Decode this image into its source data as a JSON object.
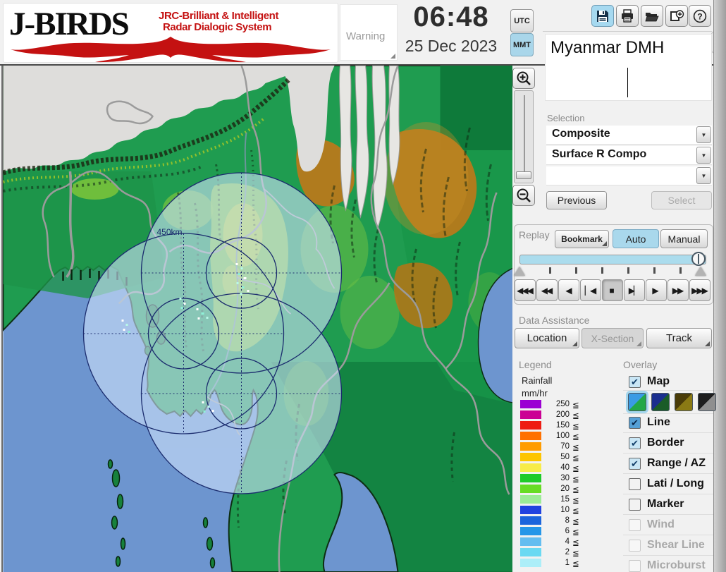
{
  "header": {
    "logo_title": "J-BIRDS",
    "logo_sub1": "JRC-Brilliant & Intelligent",
    "logo_sub2": "Radar  Dialogic  System",
    "warning_label": "Warning",
    "time": "06:48",
    "date": "25 Dec 2023",
    "tz_utc": "UTC",
    "tz_mmt": "MMT",
    "tz_selected": "MMT",
    "toolbar_icons": [
      "save-icon",
      "print-icon",
      "open-folder-icon",
      "add-image-icon",
      "help-icon"
    ],
    "station_name": "Myanmar DMH"
  },
  "selection": {
    "label": "Selection",
    "dropdown1": "Composite",
    "dropdown2": "Surface R Compo",
    "dropdown3": "",
    "previous_label": "Previous",
    "select_label": "Select",
    "select_enabled": false
  },
  "replay": {
    "label": "Replay",
    "bookmark_label": "Bookmark",
    "auto_label": "Auto",
    "manual_label": "Manual",
    "mode_selected": "Auto",
    "slider_position_pct": 100,
    "transport": [
      "◀◀◀",
      "◀◀",
      "◀",
      "▏◀",
      "■",
      "▶▏",
      "▶",
      "▶▶",
      "▶▶▶"
    ],
    "transport_names": [
      "rewind-fast",
      "rewind",
      "play-back",
      "step-first",
      "stop",
      "step-last",
      "play",
      "forward",
      "forward-fast"
    ],
    "active_transport": "stop"
  },
  "data_assistance": {
    "label": "Data Assistance",
    "buttons": [
      {
        "label": "Location",
        "enabled": true
      },
      {
        "label": "X-Section",
        "enabled": false
      },
      {
        "label": "Track",
        "enabled": true
      }
    ]
  },
  "legend": {
    "label": "Legend",
    "title1": "Rainfall",
    "title2": "mm/hr",
    "operator": "≦",
    "rows": [
      {
        "v": "250",
        "c": "#9b00d3"
      },
      {
        "v": "200",
        "c": "#cb0094"
      },
      {
        "v": "150",
        "c": "#ee1c12"
      },
      {
        "v": "100",
        "c": "#ff7100"
      },
      {
        "v": "70",
        "c": "#ff9c00"
      },
      {
        "v": "50",
        "c": "#fdc500"
      },
      {
        "v": "40",
        "c": "#f7ec49"
      },
      {
        "v": "30",
        "c": "#1ecb29"
      },
      {
        "v": "20",
        "c": "#67dc24"
      },
      {
        "v": "15",
        "c": "#9cec96"
      },
      {
        "v": "10",
        "c": "#2042e0"
      },
      {
        "v": "8",
        "c": "#1b64dc"
      },
      {
        "v": "6",
        "c": "#2596e8"
      },
      {
        "v": "4",
        "c": "#64bdf0"
      },
      {
        "v": "2",
        "c": "#6ad9f2"
      },
      {
        "v": "1",
        "c": "#aceef8"
      }
    ]
  },
  "overlay": {
    "label": "Overlay",
    "items": [
      {
        "label": "Map",
        "checked": true,
        "enabled": true
      },
      {
        "label": "Line",
        "checked": true,
        "enabled": true
      },
      {
        "label": "Border",
        "checked": true,
        "enabled": true
      },
      {
        "label": "Range / AZ",
        "checked": true,
        "enabled": true
      },
      {
        "label": "Lati / Long",
        "checked": false,
        "enabled": true
      },
      {
        "label": "Marker",
        "checked": false,
        "enabled": true
      },
      {
        "label": "Wind",
        "checked": false,
        "enabled": false
      },
      {
        "label": "Shear Line",
        "checked": false,
        "enabled": false
      },
      {
        "label": "Microburst",
        "checked": false,
        "enabled": false
      }
    ],
    "map_styles": [
      {
        "top": "#3a9be4",
        "bottom": "#23a847",
        "selected": true
      },
      {
        "top": "#1a2e8e",
        "bottom": "#1a5c28",
        "selected": false
      },
      {
        "top": "#4a3c08",
        "bottom": "#8a7a14",
        "selected": false
      },
      {
        "top": "#1d1d1d",
        "bottom": "#8f8f8f",
        "selected": false
      }
    ]
  },
  "map": {
    "range_label": "450km",
    "check_glyph": "✔",
    "dd_glyph": "▼",
    "collapse_glyph": "◀",
    "colors": {
      "sea": "#6d95cf",
      "coverage_tint": "#cfe3fb",
      "ring_stroke": "#1b2c6e",
      "land_green": "#1f9c50",
      "plateau_gray": "#dedddb",
      "mountain_orange": "#c07818",
      "border_gray": "#9b9b9b"
    }
  }
}
